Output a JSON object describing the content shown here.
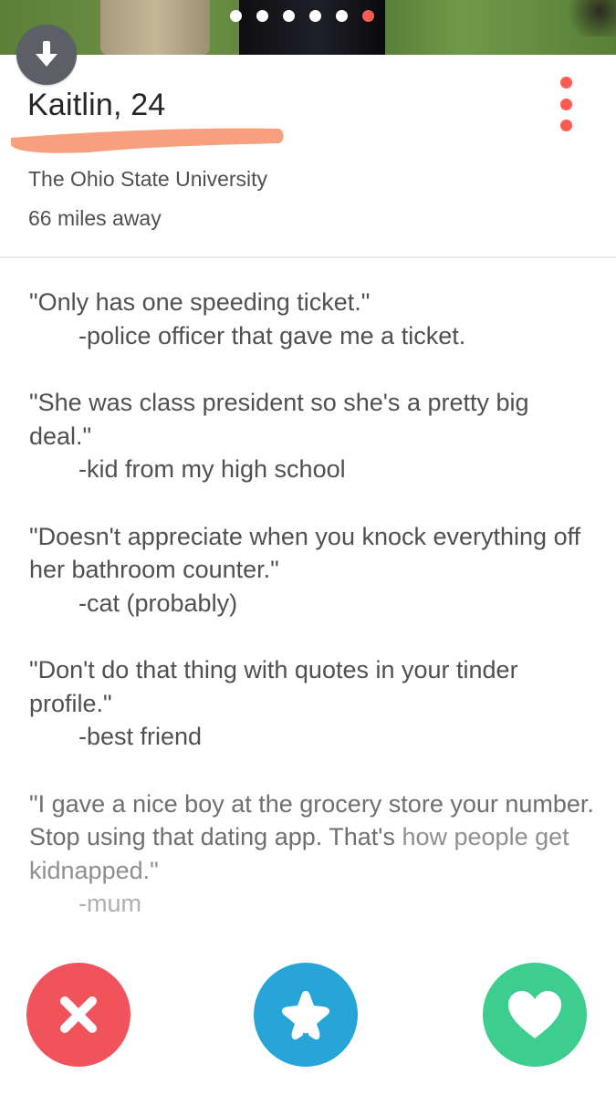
{
  "profile": {
    "name_age": "Kaitlin, 24",
    "school": "The Ohio State University",
    "distance": "66 miles away",
    "photo_count": 6,
    "active_photo": 6
  },
  "bio": [
    {
      "quote": "\"Only has one speeding ticket.\"",
      "attribution": "-police officer that gave me a ticket."
    },
    {
      "quote": "\"She was class president so she's a pretty big deal.\"",
      "attribution": "-kid from my high school"
    },
    {
      "quote": "\"Doesn't appreciate when you knock everything off her bathroom counter.\"",
      "attribution": "-cat (probably)"
    },
    {
      "quote": "\"Don't do that thing with quotes in your tinder profile.\"",
      "attribution": "-best friend"
    },
    {
      "quote_a": "\"I gave a nice boy at the grocery store your number. Stop using that dating app. That's",
      "quote_b": "how people get kidnapped.\"",
      "attribution": "-mum"
    }
  ],
  "icons": {
    "back": "arrow-down-icon",
    "menu": "vertical-dots-icon",
    "nope": "x-icon",
    "super_like": "star-icon",
    "like": "heart-icon"
  },
  "colors": {
    "accent": "#fe5b52",
    "nope": "#f1535c",
    "super_like": "#27a5d8",
    "like": "#3ccd8f",
    "redaction": "#f8a07d"
  }
}
